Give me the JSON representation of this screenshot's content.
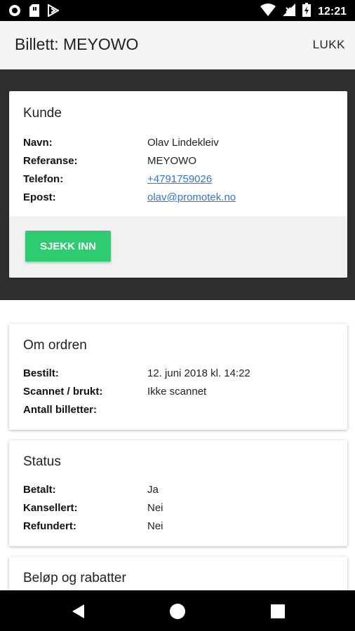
{
  "status_bar": {
    "time": "12:21"
  },
  "app_bar": {
    "title": "Billett: MEYOWO",
    "close_label": "LUKK"
  },
  "customer_card": {
    "title": "Kunde",
    "fields": [
      {
        "label": "Navn:",
        "value": "Olav Lindekleiv"
      },
      {
        "label": "Referanse:",
        "value": "MEYOWO"
      },
      {
        "label": "Telefon:",
        "value": "+4791759026"
      },
      {
        "label": "Epost:",
        "value": "olav@promotek.no"
      }
    ],
    "checkin_label": "SJEKK INN"
  },
  "order_card": {
    "title": "Om ordren",
    "fields": [
      {
        "label": "Bestilt:",
        "value": "12. juni 2018 kl. 14:22"
      },
      {
        "label": "Scannet / brukt:",
        "value": "Ikke scannet"
      },
      {
        "label": "Antall billetter:",
        "value": ""
      }
    ]
  },
  "status_card": {
    "title": "Status",
    "fields": [
      {
        "label": "Betalt:",
        "value": "Ja"
      },
      {
        "label": "Kansellert:",
        "value": "Nei"
      },
      {
        "label": "Refundert:",
        "value": "Nei"
      }
    ]
  },
  "amount_card": {
    "title": "Beløp og rabatter"
  },
  "colors": {
    "accent_green": "#2ecc71",
    "link_blue": "#3273dc",
    "dark_band": "#2f2f2f"
  },
  "icons": [
    "record-icon",
    "sim-card-icon",
    "download-icon",
    "wifi-icon",
    "no-signal-icon",
    "battery-icon",
    "back-icon",
    "home-icon",
    "recents-icon"
  ]
}
